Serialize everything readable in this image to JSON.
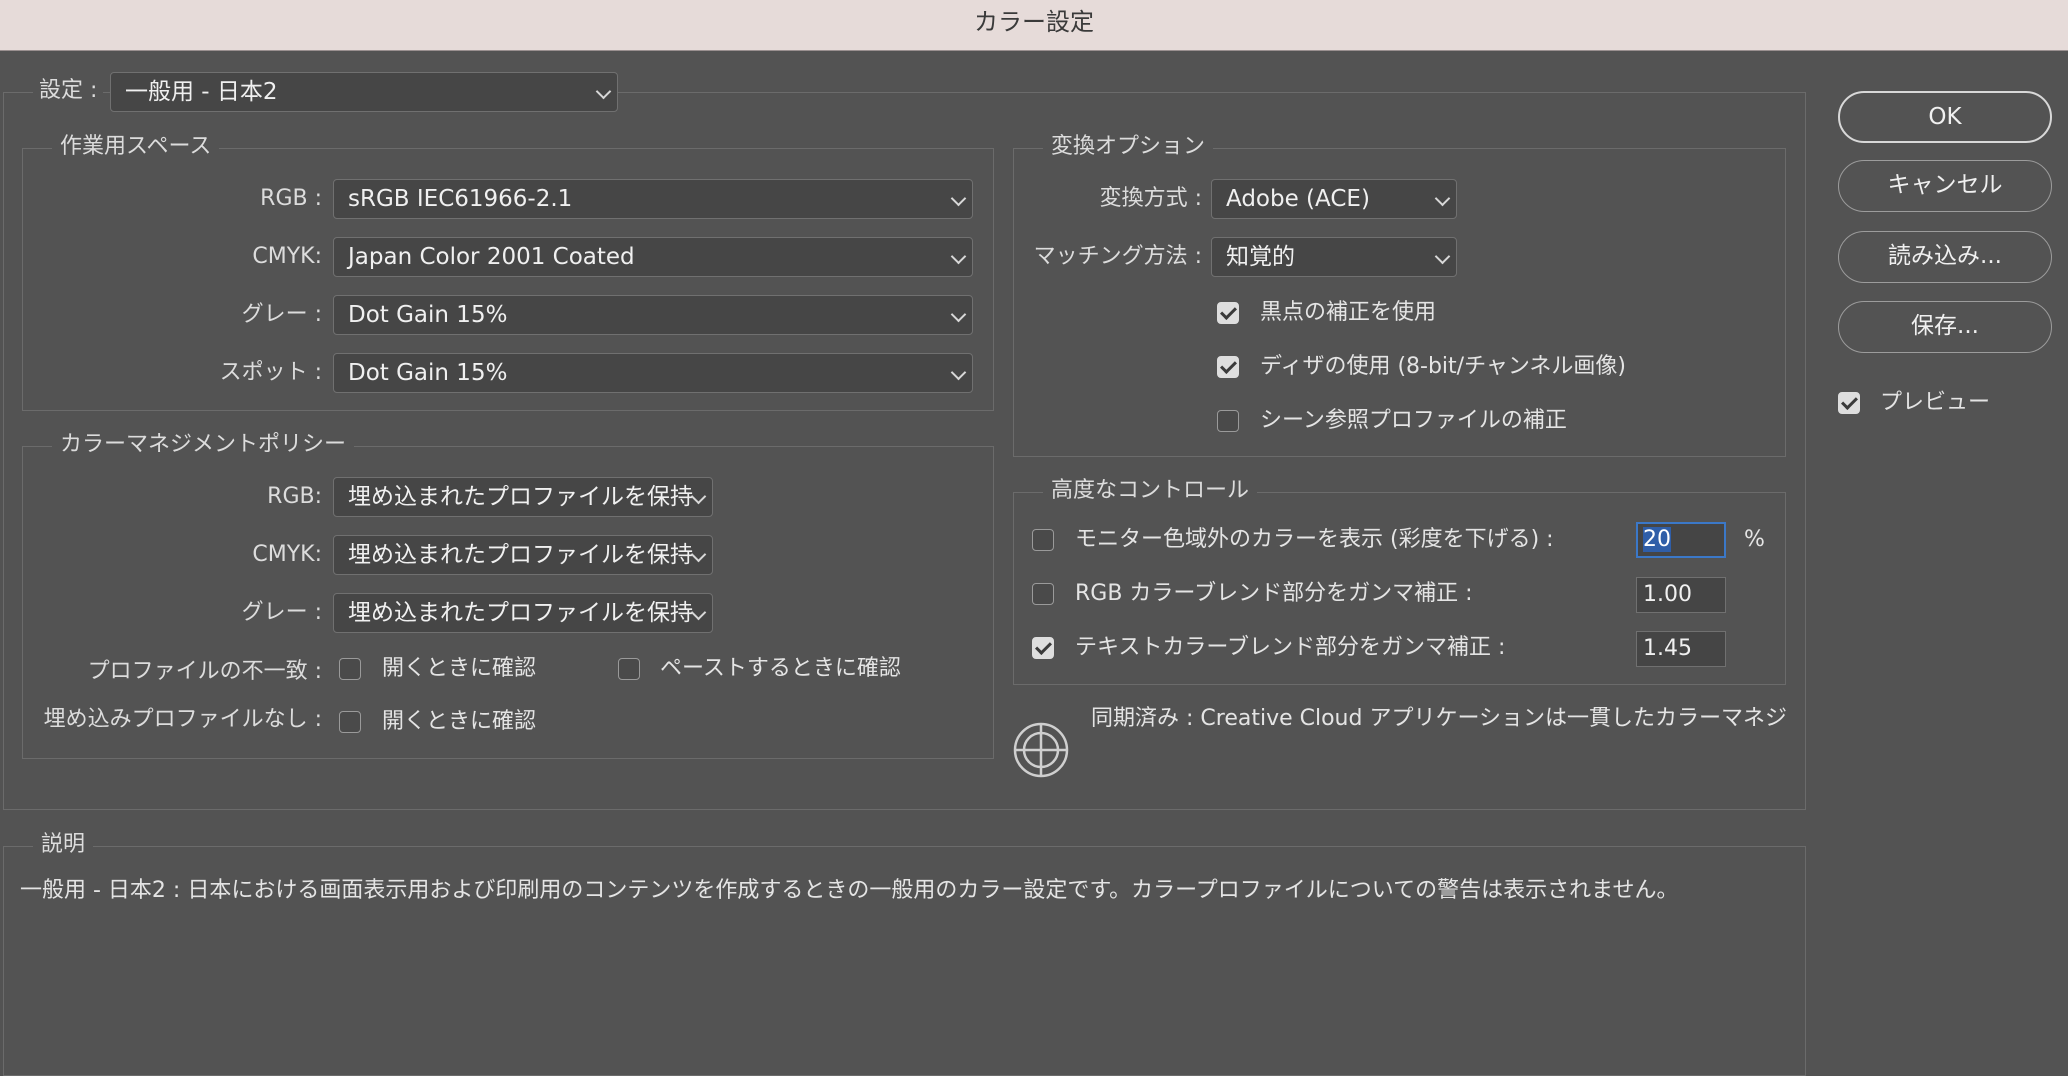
{
  "window": {
    "title": "カラー設定"
  },
  "settings": {
    "label": "設定 :",
    "value": "一般用 - 日本2"
  },
  "working_spaces": {
    "title": "作業用スペース",
    "rgb": {
      "label": "RGB :",
      "value": "sRGB IEC61966-2.1"
    },
    "cmyk": {
      "label": "CMYK:",
      "value": "Japan Color 2001 Coated"
    },
    "gray": {
      "label": "グレー :",
      "value": "Dot Gain 15%"
    },
    "spot": {
      "label": "スポット :",
      "value": "Dot Gain 15%"
    }
  },
  "policies": {
    "title": "カラーマネジメントポリシー",
    "rgb": {
      "label": "RGB:",
      "value": "埋め込まれたプロファイルを保持"
    },
    "cmyk": {
      "label": "CMYK:",
      "value": "埋め込まれたプロファイルを保持"
    },
    "gray": {
      "label": "グレー :",
      "value": "埋め込まれたプロファイルを保持"
    },
    "mismatch": {
      "label": "プロファイルの不一致 :",
      "open_label": "開くときに確認",
      "open_checked": false,
      "paste_label": "ペーストするときに確認",
      "paste_checked": false
    },
    "missing": {
      "label": "埋め込みプロファイルなし :",
      "open_label": "開くときに確認",
      "open_checked": false
    }
  },
  "conversion": {
    "title": "変換オプション",
    "engine": {
      "label": "変換方式 :",
      "value": "Adobe (ACE)"
    },
    "intent": {
      "label": "マッチング方法 :",
      "value": "知覚的"
    },
    "black_point": {
      "label": "黒点の補正を使用",
      "checked": true
    },
    "dither": {
      "label": "ディザの使用 (8-bit/チャンネル画像)",
      "checked": true
    },
    "scene_referred": {
      "label": "シーン参照プロファイルの補正",
      "checked": false
    }
  },
  "advanced": {
    "title": "高度なコントロール",
    "desaturate": {
      "label": "モニター色域外のカラーを表示 (彩度を下げる) :",
      "checked": false,
      "value": "20",
      "unit": "%"
    },
    "rgb_blend": {
      "label": "RGB カラーブレンド部分をガンマ補正 :",
      "checked": false,
      "value": "1.00"
    },
    "text_blend": {
      "label": "テキストカラーブレンド部分をガンマ補正 :",
      "checked": true,
      "value": "1.45"
    }
  },
  "sync": {
    "text": "同期済み : Creative Cloud アプリケーションは一貫したカラーマネジ…"
  },
  "description": {
    "title": "説明",
    "text": "一般用 - 日本2 :  日本における画面表示用および印刷用のコンテンツを作成するときの一般用のカラー設定です。カラープロファイルについての警告は表示されません。"
  },
  "buttons": {
    "ok": "OK",
    "cancel": "キャンセル",
    "load": "読み込み...",
    "save": "保存..."
  },
  "preview": {
    "label": "プレビュー",
    "checked": true
  },
  "colors": {
    "background": "#535353",
    "titlebar": "#e6dbd9",
    "focus": "#3b78c8"
  }
}
